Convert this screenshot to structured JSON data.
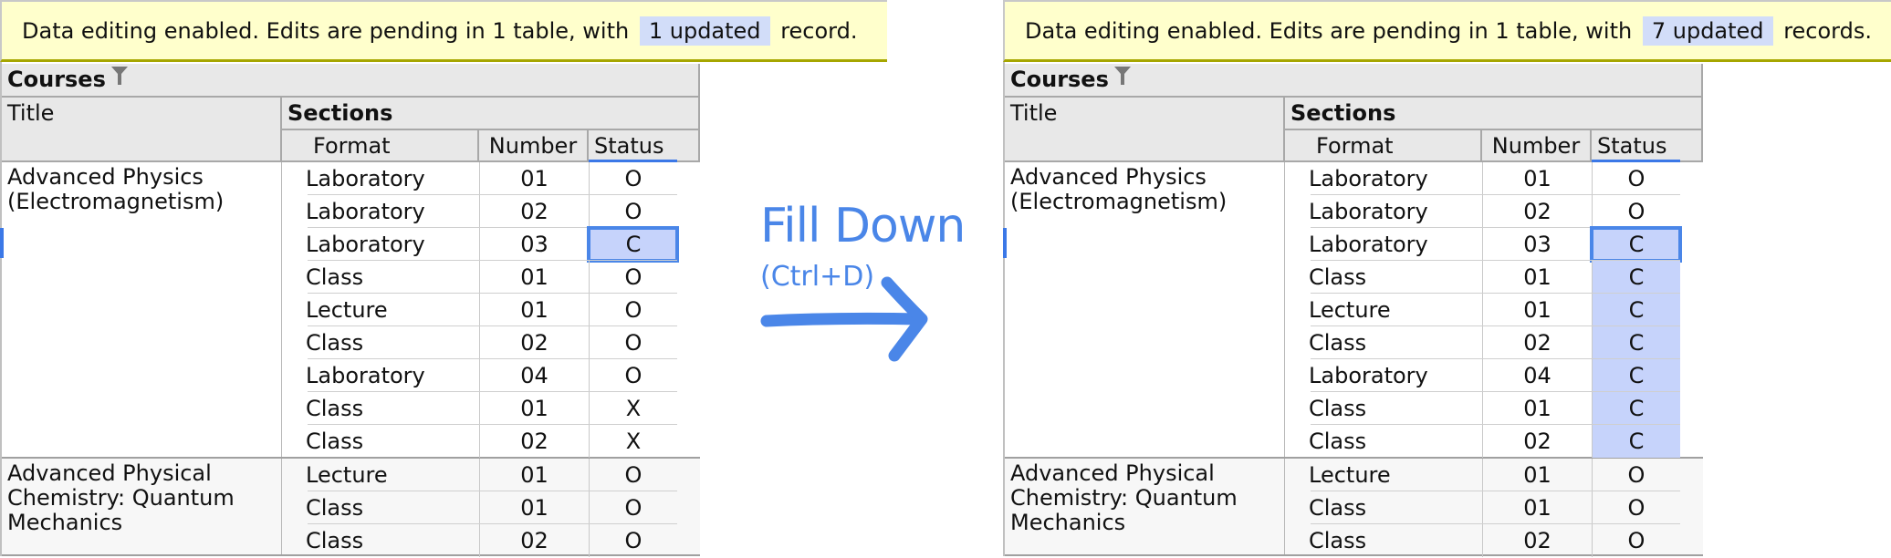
{
  "fill_down": {
    "label": "Fill Down",
    "shortcut": "(Ctrl+D)",
    "arrow_icon": "right-arrow",
    "accent_color": "#4a86e8"
  },
  "before": {
    "banner": {
      "prefix": "Data editing enabled. Edits are pending in 1 table, with",
      "highlight": "1 updated",
      "suffix": "record."
    },
    "table": {
      "name": "Courses",
      "filter_icon": "funnel-icon",
      "headers": {
        "title": "Title",
        "sections": "Sections",
        "format": "Format",
        "number": "Number",
        "status": "Status"
      },
      "records": [
        {
          "title": "Advanced Physics (Electromagnetism)",
          "sections": [
            {
              "format": "Laboratory",
              "number": "01",
              "status": "O"
            },
            {
              "format": "Laboratory",
              "number": "02",
              "status": "O"
            },
            {
              "format": "Laboratory",
              "number": "03",
              "status": "C"
            },
            {
              "format": "Class",
              "number": "01",
              "status": "O"
            },
            {
              "format": "Lecture",
              "number": "01",
              "status": "O"
            },
            {
              "format": "Class",
              "number": "02",
              "status": "O"
            },
            {
              "format": "Laboratory",
              "number": "04",
              "status": "O"
            },
            {
              "format": "Class",
              "number": "01",
              "status": "X"
            },
            {
              "format": "Class",
              "number": "02",
              "status": "X"
            }
          ]
        },
        {
          "title": "Advanced Physical Chemistry: Quantum Mechanics",
          "sections": [
            {
              "format": "Lecture",
              "number": "01",
              "status": "O"
            },
            {
              "format": "Class",
              "number": "01",
              "status": "O"
            },
            {
              "format": "Class",
              "number": "02",
              "status": "O"
            }
          ]
        }
      ]
    }
  },
  "after": {
    "banner": {
      "prefix": "Data editing enabled. Edits are pending in 1 table, with",
      "highlight": "7 updated",
      "suffix": "records."
    },
    "table": {
      "name": "Courses",
      "filter_icon": "funnel-icon",
      "headers": {
        "title": "Title",
        "sections": "Sections",
        "format": "Format",
        "number": "Number",
        "status": "Status"
      },
      "records": [
        {
          "title": "Advanced Physics (Electromagnetism)",
          "sections": [
            {
              "format": "Laboratory",
              "number": "01",
              "status": "O"
            },
            {
              "format": "Laboratory",
              "number": "02",
              "status": "O"
            },
            {
              "format": "Laboratory",
              "number": "03",
              "status": "C"
            },
            {
              "format": "Class",
              "number": "01",
              "status": "C"
            },
            {
              "format": "Lecture",
              "number": "01",
              "status": "C"
            },
            {
              "format": "Class",
              "number": "02",
              "status": "C"
            },
            {
              "format": "Laboratory",
              "number": "04",
              "status": "C"
            },
            {
              "format": "Class",
              "number": "01",
              "status": "C"
            },
            {
              "format": "Class",
              "number": "02",
              "status": "C"
            }
          ]
        },
        {
          "title": "Advanced Physical Chemistry: Quantum Mechanics",
          "sections": [
            {
              "format": "Lecture",
              "number": "01",
              "status": "O"
            },
            {
              "format": "Class",
              "number": "01",
              "status": "O"
            },
            {
              "format": "Class",
              "number": "02",
              "status": "O"
            }
          ]
        }
      ]
    }
  }
}
